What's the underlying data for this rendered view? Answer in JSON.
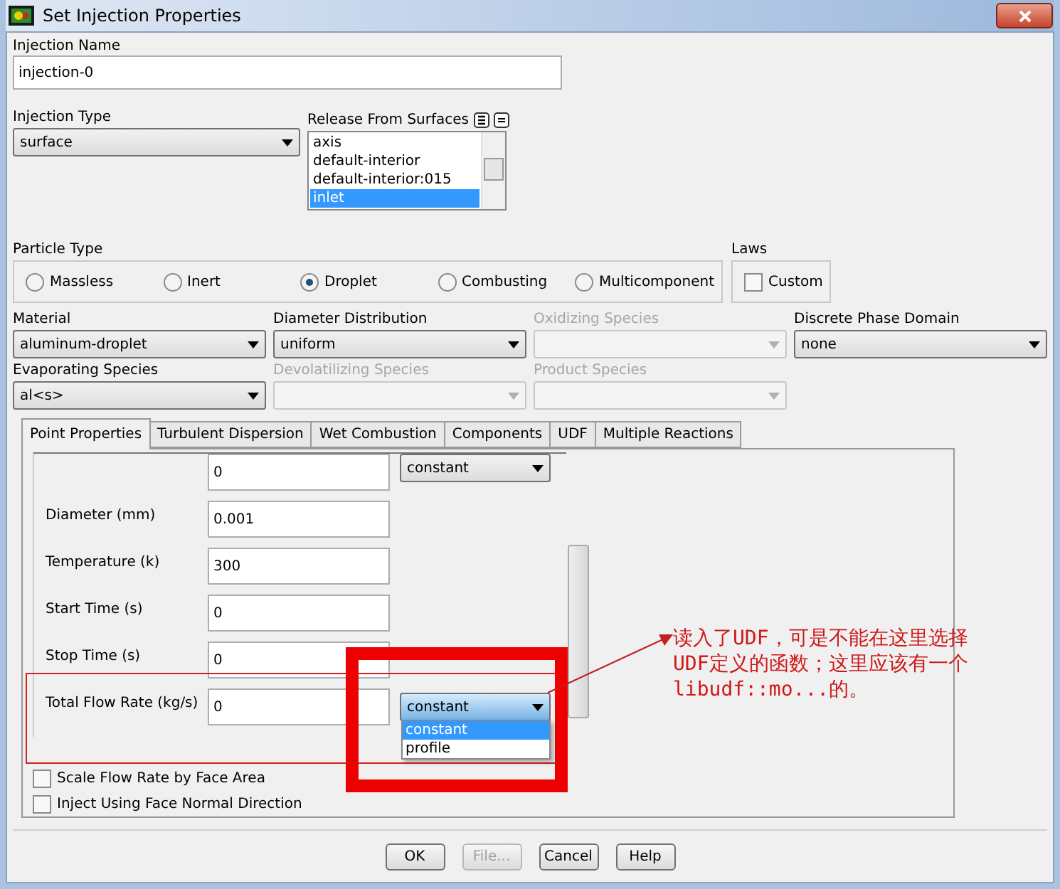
{
  "window": {
    "title": "Set Injection Properties"
  },
  "injection_name": {
    "label": "Injection Name",
    "value": "injection-0"
  },
  "injection_type": {
    "label": "Injection Type",
    "value": "surface"
  },
  "release_from_surfaces": {
    "label": "Release From Surfaces",
    "items": [
      {
        "label": "axis",
        "selected": false
      },
      {
        "label": "default-interior",
        "selected": false
      },
      {
        "label": "default-interior:015",
        "selected": false
      },
      {
        "label": "inlet",
        "selected": true
      }
    ]
  },
  "particle_type": {
    "label": "Particle Type",
    "options": [
      {
        "label": "Massless",
        "selected": false
      },
      {
        "label": "Inert",
        "selected": false
      },
      {
        "label": "Droplet",
        "selected": true
      },
      {
        "label": "Combusting",
        "selected": false
      },
      {
        "label": "Multicomponent",
        "selected": false
      }
    ]
  },
  "laws": {
    "label": "Laws",
    "custom": {
      "label": "Custom",
      "checked": false
    }
  },
  "selectors": [
    {
      "label": "Material",
      "value": "aluminum-droplet",
      "disabled": false
    },
    {
      "label": "Diameter Distribution",
      "value": "uniform",
      "disabled": false
    },
    {
      "label": "Oxidizing Species",
      "disabled": true
    },
    {
      "label": "Discrete Phase Domain",
      "value": "none",
      "disabled": false
    },
    {
      "label": "Evaporating Species",
      "value": "al<s>",
      "disabled": false
    },
    {
      "label": "Devolatilizing Species",
      "disabled": true
    },
    {
      "label": "Product Species",
      "disabled": true
    }
  ],
  "tabs": [
    {
      "label": "Point Properties",
      "selected": true
    },
    {
      "label": "Turbulent Dispersion",
      "selected": false
    },
    {
      "label": "Wet Combustion",
      "selected": false
    },
    {
      "label": "Components",
      "selected": false
    },
    {
      "label": "UDF",
      "selected": false
    },
    {
      "label": "Multiple Reactions",
      "selected": false
    }
  ],
  "point_properties": [
    {
      "value": "0",
      "method": "constant",
      "expanded": false
    },
    {
      "label": "Diameter (mm)",
      "value": "0.001"
    },
    {
      "label": "Temperature (k)",
      "value": "300"
    },
    {
      "label": "Start Time (s)",
      "value": "0"
    },
    {
      "label": "Stop Time (s)",
      "value": "0"
    },
    {
      "label": "Total Flow Rate (kg/s)",
      "value": "0",
      "method": "constant",
      "expanded": true,
      "options": [
        {
          "label": "constant",
          "selected": true
        },
        {
          "label": "profile",
          "selected": false
        }
      ]
    }
  ],
  "options": [
    {
      "label": "Scale Flow Rate by Face Area",
      "checked": false
    },
    {
      "label": "Inject Using Face Normal Direction",
      "checked": false
    }
  ],
  "buttons": [
    {
      "label": "OK",
      "disabled": false
    },
    {
      "label": "File...",
      "disabled": true
    },
    {
      "label": "Cancel",
      "disabled": false
    },
    {
      "label": "Help",
      "disabled": false
    }
  ],
  "annotation": {
    "lines": [
      "读入了UDF，可是不能在这里选择",
      "UDF定义的函数；这里应该有一个",
      "libudf::mo...的。"
    ]
  }
}
